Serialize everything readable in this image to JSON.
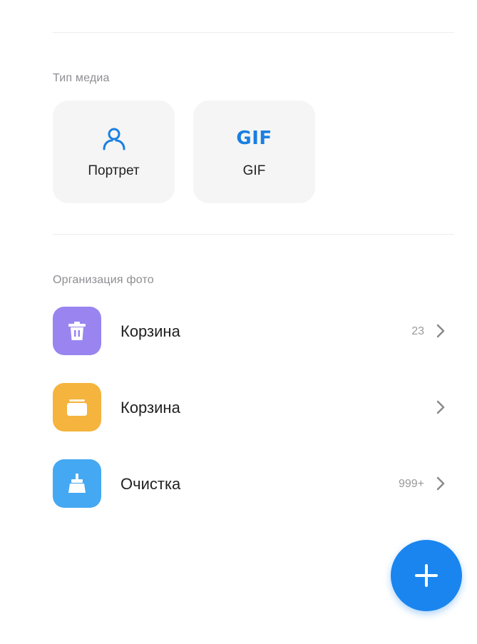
{
  "media_section": {
    "label": "Тип медиа",
    "cards": [
      {
        "label": "Портрет",
        "icon": "person-outline-icon"
      },
      {
        "label": "GIF",
        "icon_text": "GIF",
        "icon": "gif-icon"
      }
    ]
  },
  "organize_section": {
    "label": "Организация фото",
    "rows": [
      {
        "label": "Корзина",
        "count": "23",
        "icon": "trash-icon",
        "color": "#9a85f0"
      },
      {
        "label": "Корзина",
        "count": "",
        "icon": "folder-icon",
        "color": "#f5b43d"
      },
      {
        "label": "Очистка",
        "count": "999+",
        "icon": "broom-icon",
        "color": "#45a8f2"
      }
    ]
  },
  "fab": {
    "icon": "plus-icon",
    "color": "#1a85ee"
  },
  "colors": {
    "accent": "#1a7fe0",
    "card_bg": "#f5f5f5",
    "divider": "#ececec"
  }
}
